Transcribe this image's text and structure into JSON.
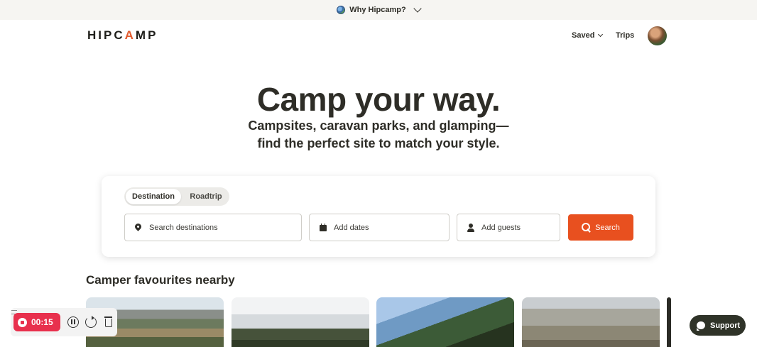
{
  "announcement": {
    "text": "Why Hipcamp?",
    "icon": "globe-icon"
  },
  "header": {
    "logo": {
      "pre": "HIPC",
      "accent": "A",
      "post": "MP"
    },
    "nav": {
      "saved": "Saved",
      "trips": "Trips"
    }
  },
  "hero": {
    "title": "Camp your way.",
    "subtitle": "Campsites, caravan parks, and glamping—find the perfect site to match your style."
  },
  "search": {
    "tabs": {
      "destination": "Destination",
      "roadtrip": "Roadtrip",
      "active": "Destination"
    },
    "destination_placeholder": "Search destinations",
    "dates_placeholder": "Add dates",
    "guests_placeholder": "Add guests",
    "button_label": "Search"
  },
  "favourites": {
    "title": "Camper favourites nearby"
  },
  "recorder": {
    "time": "00:15"
  },
  "support": {
    "label": "Support"
  },
  "colors": {
    "brand_orange": "#e8501f",
    "text_dark": "#2e2d27",
    "recorder_red": "#e8304d",
    "support_bg": "#2f3328"
  }
}
